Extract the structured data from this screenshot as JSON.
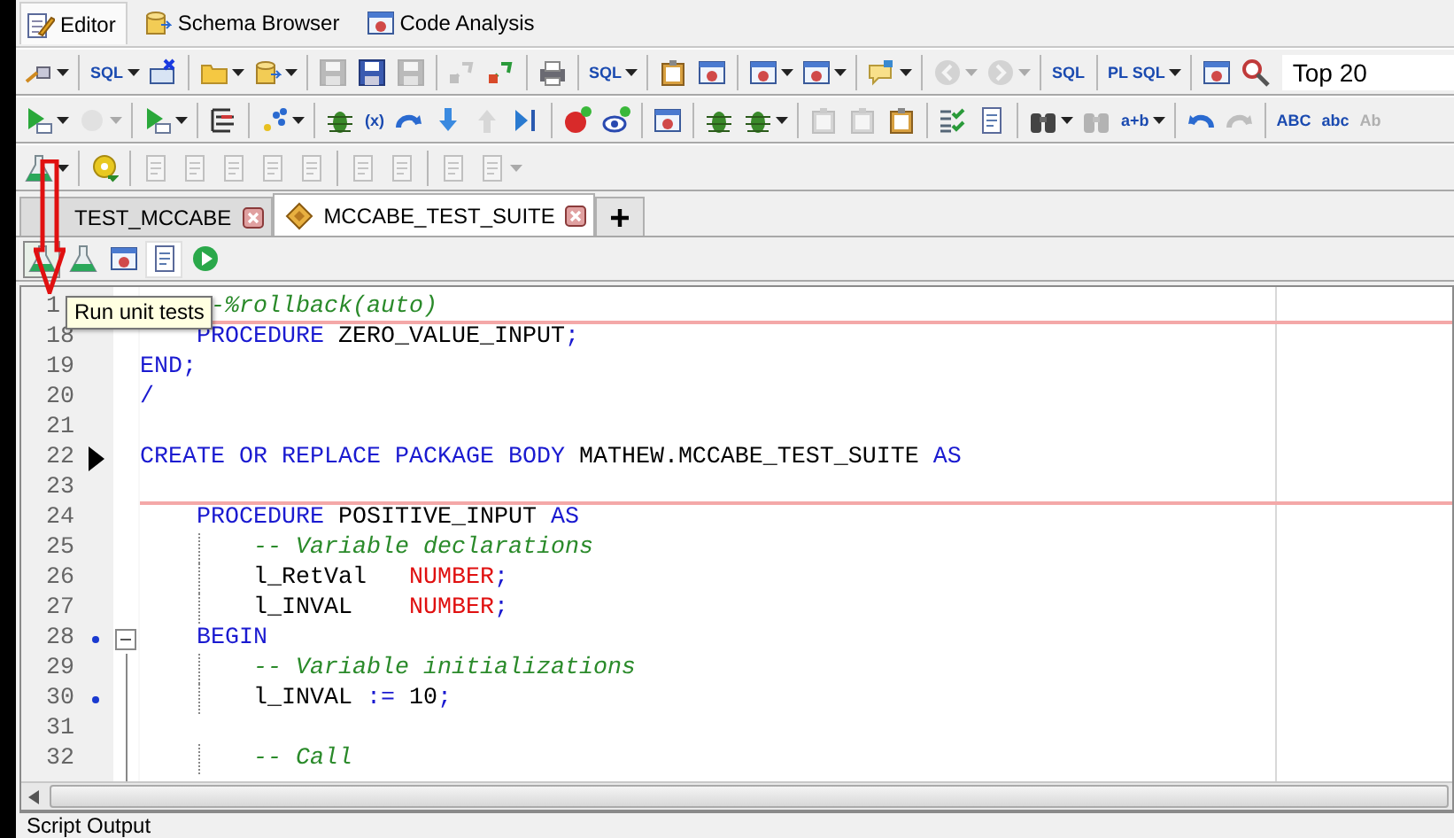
{
  "perspectives": [
    {
      "label": "Editor",
      "selected": true
    },
    {
      "label": "Schema Browser",
      "selected": false
    },
    {
      "label": "Code Analysis",
      "selected": false
    }
  ],
  "toolbars": [
    {
      "items": [
        {
          "kind": "button",
          "disabled": false,
          "menu": true
        },
        {
          "kind": "separator"
        },
        {
          "kind": "button",
          "disabled": false,
          "menu": true,
          "glyph": "SQL"
        },
        {
          "kind": "button",
          "disabled": false,
          "menu": false
        },
        {
          "kind": "separator"
        },
        {
          "kind": "button",
          "disabled": false,
          "menu": true
        },
        {
          "kind": "button",
          "disabled": false,
          "menu": true
        },
        {
          "kind": "separator"
        },
        {
          "kind": "button",
          "disabled": true,
          "menu": false
        },
        {
          "kind": "button",
          "disabled": false,
          "menu": false
        },
        {
          "kind": "button",
          "disabled": true,
          "menu": false
        },
        {
          "kind": "separator"
        },
        {
          "kind": "button",
          "disabled": true,
          "menu": false
        },
        {
          "kind": "button",
          "disabled": false,
          "menu": false
        },
        {
          "kind": "separator"
        },
        {
          "kind": "button",
          "disabled": false,
          "menu": false
        },
        {
          "kind": "separator"
        },
        {
          "kind": "button",
          "disabled": false,
          "menu": true,
          "glyph": "SQL"
        },
        {
          "kind": "separator"
        },
        {
          "kind": "button",
          "disabled": false,
          "menu": false
        },
        {
          "kind": "button",
          "disabled": false,
          "menu": false
        },
        {
          "kind": "separator"
        },
        {
          "kind": "button",
          "disabled": false,
          "menu": true
        },
        {
          "kind": "button",
          "disabled": false,
          "menu": true
        },
        {
          "kind": "separator"
        },
        {
          "kind": "button",
          "disabled": false,
          "menu": true
        },
        {
          "kind": "separator"
        },
        {
          "kind": "button",
          "disabled": true,
          "menu": true
        },
        {
          "kind": "button",
          "disabled": true,
          "menu": true
        },
        {
          "kind": "separator"
        },
        {
          "kind": "button",
          "disabled": false,
          "menu": false,
          "glyph": "SQL"
        },
        {
          "kind": "separator"
        },
        {
          "kind": "button",
          "disabled": false,
          "menu": true,
          "glyph": "PL SQL"
        },
        {
          "kind": "separator"
        },
        {
          "kind": "button",
          "disabled": false,
          "menu": false
        },
        {
          "kind": "button",
          "disabled": false,
          "menu": false
        },
        {
          "kind": "field",
          "value": "Top 20"
        }
      ]
    },
    {
      "items": [
        {
          "kind": "button",
          "disabled": false,
          "menu": true
        },
        {
          "kind": "button",
          "disabled": true,
          "menu": true
        },
        {
          "kind": "separator"
        },
        {
          "kind": "button",
          "disabled": false,
          "menu": true
        },
        {
          "kind": "separator"
        },
        {
          "kind": "button",
          "disabled": false,
          "menu": false
        },
        {
          "kind": "separator"
        },
        {
          "kind": "button",
          "disabled": false,
          "menu": true
        },
        {
          "kind": "separator"
        },
        {
          "kind": "button",
          "disabled": false,
          "menu": false
        },
        {
          "kind": "button",
          "disabled": false,
          "menu": false,
          "glyph": "(x)"
        },
        {
          "kind": "button",
          "disabled": false,
          "menu": false
        },
        {
          "kind": "button",
          "disabled": false,
          "menu": false
        },
        {
          "kind": "button",
          "disabled": true,
          "menu": false
        },
        {
          "kind": "button",
          "disabled": false,
          "menu": false
        },
        {
          "kind": "separator"
        },
        {
          "kind": "button",
          "disabled": false,
          "menu": false
        },
        {
          "kind": "button",
          "disabled": false,
          "menu": false
        },
        {
          "kind": "separator"
        },
        {
          "kind": "button",
          "disabled": false,
          "menu": false
        },
        {
          "kind": "separator"
        },
        {
          "kind": "button",
          "disabled": false,
          "menu": false
        },
        {
          "kind": "button",
          "disabled": false,
          "menu": true
        },
        {
          "kind": "separator"
        },
        {
          "kind": "button",
          "disabled": true,
          "menu": false
        },
        {
          "kind": "button",
          "disabled": true,
          "menu": false
        },
        {
          "kind": "button",
          "disabled": false,
          "menu": false
        },
        {
          "kind": "separator"
        },
        {
          "kind": "button",
          "disabled": false,
          "menu": false
        },
        {
          "kind": "button",
          "disabled": false,
          "menu": false
        },
        {
          "kind": "separator"
        },
        {
          "kind": "button",
          "disabled": false,
          "menu": true
        },
        {
          "kind": "button",
          "disabled": true,
          "menu": false
        },
        {
          "kind": "button",
          "disabled": false,
          "menu": true,
          "glyph": "a+b"
        },
        {
          "kind": "separator"
        },
        {
          "kind": "button",
          "disabled": false,
          "menu": false
        },
        {
          "kind": "button",
          "disabled": true,
          "menu": false
        },
        {
          "kind": "separator"
        },
        {
          "kind": "button",
          "disabled": false,
          "menu": false,
          "glyph": "ABC"
        },
        {
          "kind": "button",
          "disabled": false,
          "menu": false,
          "glyph": "abc"
        },
        {
          "kind": "button",
          "disabled": true,
          "menu": false,
          "glyph": "Ab"
        }
      ]
    },
    {
      "items": [
        {
          "kind": "button",
          "disabled": false,
          "menu": true
        },
        {
          "kind": "separator"
        },
        {
          "kind": "button",
          "disabled": false,
          "menu": false
        },
        {
          "kind": "separator"
        },
        {
          "kind": "button",
          "disabled": true,
          "menu": false
        },
        {
          "kind": "button",
          "disabled": true,
          "menu": false
        },
        {
          "kind": "button",
          "disabled": true,
          "menu": false
        },
        {
          "kind": "button",
          "disabled": true,
          "menu": false
        },
        {
          "kind": "button",
          "disabled": true,
          "menu": false
        },
        {
          "kind": "separator"
        },
        {
          "kind": "button",
          "disabled": true,
          "menu": false
        },
        {
          "kind": "button",
          "disabled": true,
          "menu": false
        },
        {
          "kind": "separator"
        },
        {
          "kind": "button",
          "disabled": true,
          "menu": false
        },
        {
          "kind": "button",
          "disabled": true,
          "menu": true
        }
      ]
    }
  ],
  "tabs": [
    {
      "label": "TEST_MCCABE",
      "selected": false
    },
    {
      "label": "MCCABE_TEST_SUITE",
      "selected": true
    }
  ],
  "editor_toolbar": [
    {
      "hovered": true,
      "selected": false
    },
    {
      "hovered": false,
      "selected": false
    },
    {
      "hovered": false,
      "selected": false
    },
    {
      "hovered": false,
      "selected": true
    },
    {
      "hovered": false,
      "selected": false
    }
  ],
  "tooltip": "Run unit tests",
  "lines": [
    {
      "number": "1",
      "current": false,
      "bookmark": false,
      "separator_below": true,
      "tokens": [
        {
          "text": "     -%rollback(auto)",
          "kind": "comment"
        }
      ]
    },
    {
      "number": "18",
      "current": false,
      "bookmark": false,
      "separator_below": false,
      "tokens": [
        {
          "text": "    PROCEDURE",
          "kind": "keyword"
        },
        {
          "text": " ZERO_VALUE_INPUT",
          "kind": "name"
        },
        {
          "text": ";",
          "kind": "operator"
        }
      ]
    },
    {
      "number": "19",
      "current": false,
      "bookmark": false,
      "separator_below": false,
      "tokens": [
        {
          "text": "END",
          "kind": "keyword"
        },
        {
          "text": ";",
          "kind": "operator"
        }
      ]
    },
    {
      "number": "20",
      "current": false,
      "bookmark": false,
      "separator_below": false,
      "tokens": [
        {
          "text": "/",
          "kind": "operator"
        }
      ]
    },
    {
      "number": "21",
      "current": false,
      "bookmark": false,
      "separator_below": false
    },
    {
      "number": "22",
      "current": true,
      "bookmark": false,
      "separator_below": false,
      "tokens": [
        {
          "text": "CREATE OR REPLACE PACKAGE BODY",
          "kind": "keyword"
        },
        {
          "text": " MATHEW.MCCABE_TEST_SUITE",
          "kind": "name"
        },
        {
          "text": " AS",
          "kind": "keyword"
        }
      ]
    },
    {
      "number": "23",
      "current": false,
      "bookmark": false,
      "separator_below": true
    },
    {
      "number": "24",
      "current": false,
      "bookmark": false,
      "separator_below": false,
      "tokens": [
        {
          "text": "    PROCEDURE",
          "kind": "keyword"
        },
        {
          "text": " POSITIVE_INPUT",
          "kind": "name"
        },
        {
          "text": " AS",
          "kind": "keyword"
        }
      ]
    },
    {
      "number": "25",
      "current": false,
      "bookmark": false,
      "separator_below": false,
      "tokens": [
        {
          "text": "        -- Variable declarations",
          "kind": "comment"
        }
      ]
    },
    {
      "number": "26",
      "current": false,
      "bookmark": false,
      "separator_below": false,
      "tokens": [
        {
          "text": "        l_RetVal",
          "kind": "name"
        },
        {
          "text": "   NUMBER",
          "kind": "type"
        },
        {
          "text": ";",
          "kind": "operator"
        }
      ]
    },
    {
      "number": "27",
      "current": false,
      "bookmark": false,
      "separator_below": false,
      "tokens": [
        {
          "text": "        l_INVAL",
          "kind": "name"
        },
        {
          "text": "    NUMBER",
          "kind": "type"
        },
        {
          "text": ";",
          "kind": "operator"
        }
      ]
    },
    {
      "number": "28",
      "current": false,
      "bookmark": true,
      "separator_below": false,
      "fold_expanded": true,
      "tokens": [
        {
          "text": "    BEGIN",
          "kind": "keyword"
        }
      ]
    },
    {
      "number": "29",
      "current": false,
      "bookmark": false,
      "separator_below": false,
      "tokens": [
        {
          "text": "        -- Variable initializations",
          "kind": "comment"
        }
      ]
    },
    {
      "number": "30",
      "current": false,
      "bookmark": true,
      "separator_below": false,
      "tokens": [
        {
          "text": "        l_INVAL",
          "kind": "name"
        },
        {
          "text": " :=",
          "kind": "operator"
        },
        {
          "text": " 10",
          "kind": "name"
        },
        {
          "text": ";",
          "kind": "operator"
        }
      ]
    },
    {
      "number": "31",
      "current": false,
      "bookmark": false,
      "separator_below": false
    },
    {
      "number": "32",
      "current": false,
      "bookmark": false,
      "separator_below": false,
      "tokens": [
        {
          "text": "        -- Call",
          "kind": "comment"
        }
      ]
    }
  ],
  "bottom_panel": {
    "title": "Script Output"
  }
}
